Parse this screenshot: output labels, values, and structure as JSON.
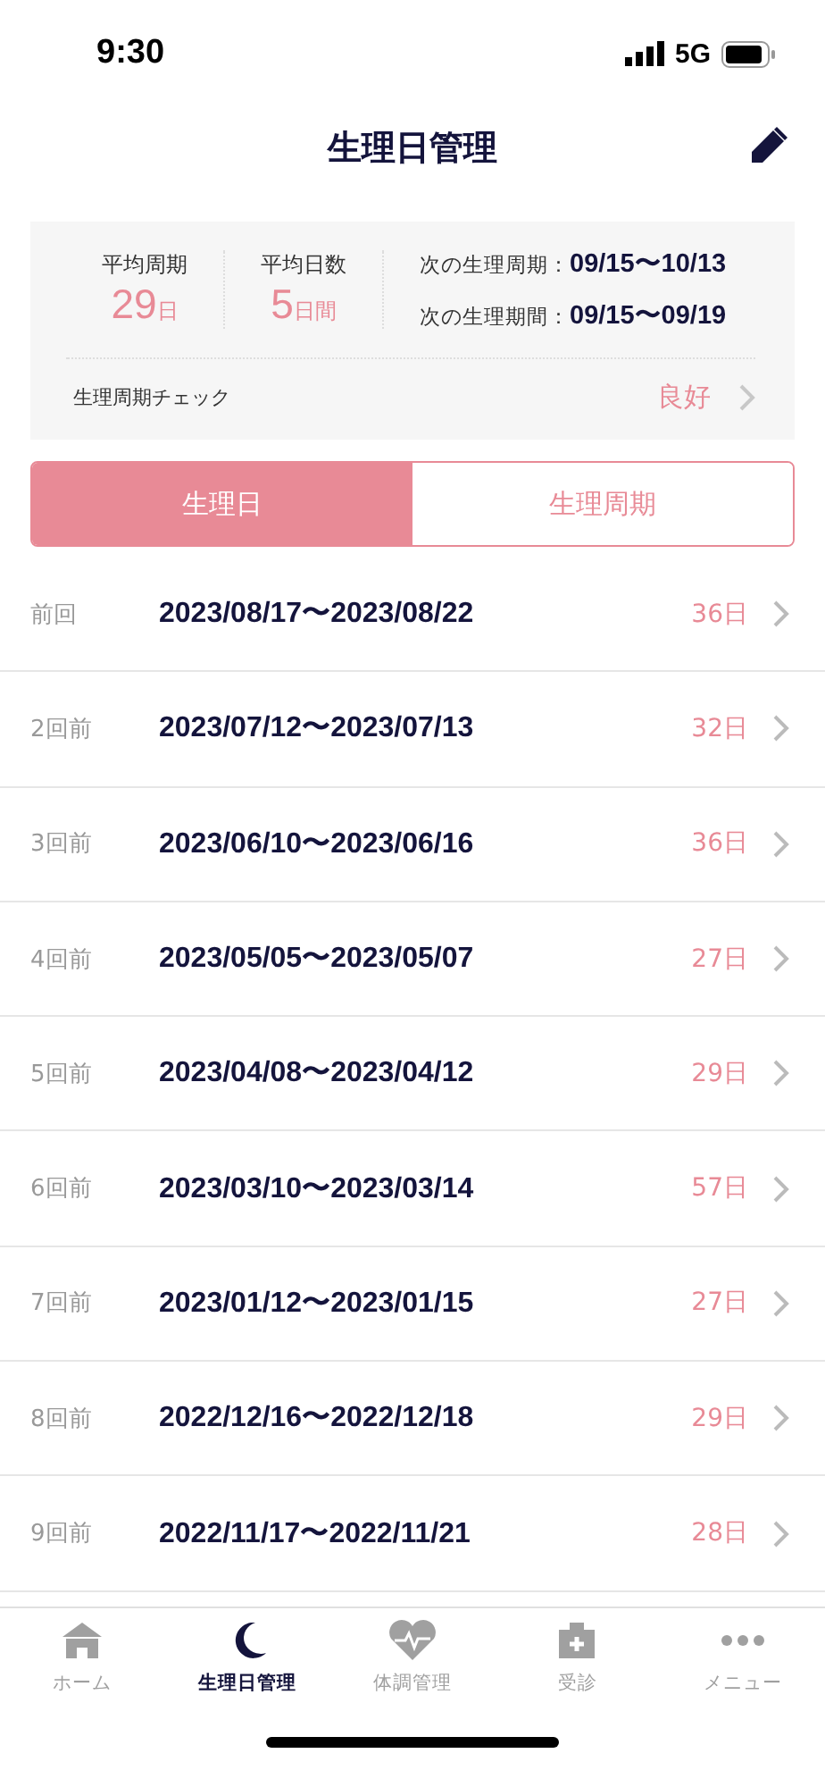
{
  "status_bar": {
    "time": "9:30",
    "network": "5G"
  },
  "header": {
    "title": "生理日管理"
  },
  "summary": {
    "stats": [
      {
        "label": "平均周期",
        "value": "29",
        "unit": "日"
      },
      {
        "label": "平均日数",
        "value": "5",
        "unit": "日間"
      }
    ],
    "next": [
      {
        "label": "次の生理周期：",
        "value": "09/15〜10/13"
      },
      {
        "label": "次の生理期間：",
        "value": "09/15〜09/19"
      }
    ],
    "check": {
      "label": "生理周期チェック",
      "result": "良好"
    }
  },
  "tabs": [
    {
      "label": "生理日",
      "selected": true
    },
    {
      "label": "生理周期",
      "selected": false
    }
  ],
  "periods": [
    {
      "label": "前回",
      "range": "2023/08/17〜2023/08/22",
      "days": "36日"
    },
    {
      "label": "2回前",
      "range": "2023/07/12〜2023/07/13",
      "days": "32日"
    },
    {
      "label": "3回前",
      "range": "2023/06/10〜2023/06/16",
      "days": "36日"
    },
    {
      "label": "4回前",
      "range": "2023/05/05〜2023/05/07",
      "days": "27日"
    },
    {
      "label": "5回前",
      "range": "2023/04/08〜2023/04/12",
      "days": "29日"
    },
    {
      "label": "6回前",
      "range": "2023/03/10〜2023/03/14",
      "days": "57日"
    },
    {
      "label": "7回前",
      "range": "2023/01/12〜2023/01/15",
      "days": "27日"
    },
    {
      "label": "8回前",
      "range": "2022/12/16〜2022/12/18",
      "days": "29日"
    },
    {
      "label": "9回前",
      "range": "2022/11/17〜2022/11/21",
      "days": "28日"
    }
  ],
  "nav": [
    {
      "kind": "home",
      "label": "ホーム",
      "selected": false
    },
    {
      "kind": "moon",
      "label": "生理日管理",
      "selected": true
    },
    {
      "kind": "heart",
      "label": "体調管理",
      "selected": false
    },
    {
      "kind": "clinic",
      "label": "受診",
      "selected": false
    },
    {
      "kind": "more",
      "label": "メニュー",
      "selected": false
    }
  ]
}
